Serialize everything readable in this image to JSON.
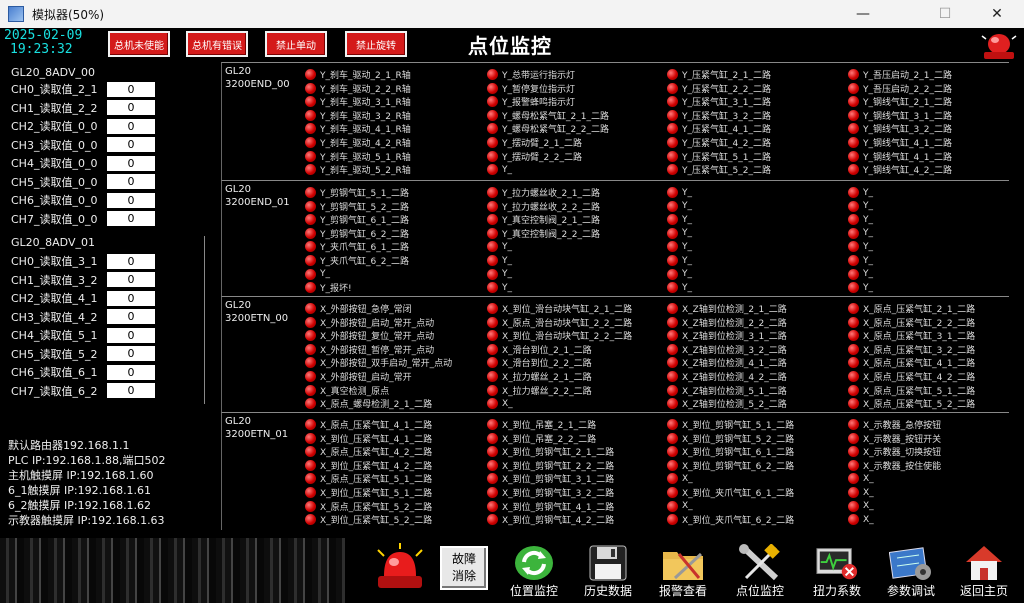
{
  "window": {
    "title": "模拟器(50%)",
    "minimize": "—",
    "maximize": "☐",
    "close": "✕"
  },
  "clock": {
    "date": "2025-02-09",
    "time": "19:23:32"
  },
  "top_buttons": [
    "总机未使能",
    "总机有错误",
    "禁止单动",
    "禁止旋转"
  ],
  "page_title": "点位监控",
  "modules": [
    {
      "title": "GL20_8ADV_00",
      "channels": [
        {
          "label": "CH0_读取值_2_1",
          "value": "0"
        },
        {
          "label": "CH1_读取值_2_2",
          "value": "0"
        },
        {
          "label": "CH2_读取值_0_0",
          "value": "0"
        },
        {
          "label": "CH3_读取值_0_0",
          "value": "0"
        },
        {
          "label": "CH4_读取值_0_0",
          "value": "0"
        },
        {
          "label": "CH5_读取值_0_0",
          "value": "0"
        },
        {
          "label": "CH6_读取值_0_0",
          "value": "0"
        },
        {
          "label": "CH7_读取值_0_0",
          "value": "0"
        }
      ]
    },
    {
      "title": "GL20_8ADV_01",
      "channels": [
        {
          "label": "CH0_读取值_3_1",
          "value": "0"
        },
        {
          "label": "CH1_读取值_3_2",
          "value": "0"
        },
        {
          "label": "CH2_读取值_4_1",
          "value": "0"
        },
        {
          "label": "CH3_读取值_4_2",
          "value": "0"
        },
        {
          "label": "CH4_读取值_5_1",
          "value": "0"
        },
        {
          "label": "CH5_读取值_5_2",
          "value": "0"
        },
        {
          "label": "CH6_读取值_6_1",
          "value": "0"
        },
        {
          "label": "CH7_读取值_6_2",
          "value": "0"
        }
      ]
    }
  ],
  "network_info": [
    "默认路由器192.168.1.1",
    "PLC IP:192.168.1.88,端口502",
    "主机触摸屏 IP:192.168.1.60",
    "6_1触摸屏 IP:192.168.1.61",
    "6_2触摸屏 IP:192.168.1.62",
    "示教器触摸屏 IP:192.168.1.63"
  ],
  "io_groups": [
    {
      "name": [
        "GL20",
        "3200END_00"
      ],
      "columns": [
        [
          "Y_刹车_驱动_2_1_R轴",
          "Y_刹车_驱动_2_2_R轴",
          "Y_刹车_驱动_3_1_R轴",
          "Y_刹车_驱动_3_2_R轴",
          "Y_刹车_驱动_4_1_R轴",
          "Y_刹车_驱动_4_2_R轴",
          "Y_刹车_驱动_5_1_R轴",
          "Y_刹车_驱动_5_2_R轴"
        ],
        [
          "Y_总带运行指示灯",
          "Y_暂停复位指示灯",
          "Y_报警蜂鸣指示灯",
          "Y_螺母松紧气缸_2_1_二路",
          "Y_螺母松紧气缸_2_2_二路",
          "Y_摆动臂_2_1_二路",
          "Y_摆动臂_2_2_二路",
          "Y_"
        ],
        [
          "Y_压紧气缸_2_1_二路",
          "Y_压紧气缸_2_2_二路",
          "Y_压紧气缸_3_1_二路",
          "Y_压紧气缸_3_2_二路",
          "Y_压紧气缸_4_1_二路",
          "Y_压紧气缸_4_2_二路",
          "Y_压紧气缸_5_1_二路",
          "Y_压紧气缸_5_2_二路"
        ],
        [
          "Y_吾压启动_2_1_二路",
          "Y_吾压启动_2_2_二路",
          "Y_钢线气缸_2_1_二路",
          "Y_钢线气缸_3_1_二路",
          "Y_钢线气缸_3_2_二路",
          "Y_钢线气缸_4_1_二路",
          "Y_钢线气缸_4_1_二路",
          "Y_钢线气缸_4_2_二路"
        ]
      ]
    },
    {
      "name": [
        "GL20",
        "3200END_01"
      ],
      "columns": [
        [
          "Y_剪钢气缸_5_1_二路",
          "Y_剪钢气缸_5_2_二路",
          "Y_剪钢气缸_6_1_二路",
          "Y_剪钢气缸_6_2_二路",
          "Y_夹爪气缸_6_1_二路",
          "Y_夹爪气缸_6_2_二路",
          "Y_",
          "Y_报坏!"
        ],
        [
          "Y_拉力螺丝收_2_1_二路",
          "Y_拉力螺丝收_2_2_二路",
          "Y_真空控制阀_2_1_二路",
          "Y_真空控制阀_2_2_二路",
          "Y_",
          "Y_",
          "Y_",
          "Y_"
        ],
        [
          "Y_",
          "Y_",
          "Y_",
          "Y_",
          "Y_",
          "Y_",
          "Y_",
          "Y_"
        ],
        [
          "Y_",
          "Y_",
          "Y_",
          "Y_",
          "Y_",
          "Y_",
          "Y_",
          "Y_"
        ]
      ]
    },
    {
      "name": [
        "GL20",
        "3200ETN_00"
      ],
      "columns": [
        [
          "X_外部按钮_急停_常闭",
          "X_外部按钮_启动_常开_点动",
          "X_外部按钮_复位_常开_点动",
          "X_外部按钮_暂停_常开_点动",
          "X_外部按钮_双手启动_常开_点动",
          "X_外部按钮_启动_常开",
          "X_真空检测_原点",
          "X_原点_螺母检测_2_1_二路"
        ],
        [
          "X_到位_滑台动块气缸_2_1_二路",
          "X_原点_滑台动块气缸_2_2_二路",
          "X_到位_滑台动块气缸_2_2_二路",
          "X_滑台到位_2_1_二路",
          "X_滑台到位_2_2_二路",
          "X_拉力螺丝_2_1_二路",
          "X_拉力螺丝_2_2_二路",
          "X_"
        ],
        [
          "X_Z轴到位检测_2_1_二路",
          "X_Z轴到位检测_2_2_二路",
          "X_Z轴到位检测_3_1_二路",
          "X_Z轴到位检测_3_2_二路",
          "X_Z轴到位检测_4_1_二路",
          "X_Z轴到位检测_4_2_二路",
          "X_Z轴到位检测_5_1_二路",
          "X_Z轴到位检测_5_2_二路"
        ],
        [
          "X_原点_压紧气缸_2_1_二路",
          "X_原点_压紧气缸_2_2_二路",
          "X_原点_压紧气缸_3_1_二路",
          "X_原点_压紧气缸_3_2_二路",
          "X_原点_压紧气缸_4_1_二路",
          "X_原点_压紧气缸_4_2_二路",
          "X_原点_压紧气缸_5_1_二路",
          "X_原点_压紧气缸_5_2_二路"
        ]
      ]
    },
    {
      "name": [
        "GL20",
        "3200ETN_01"
      ],
      "columns": [
        [
          "X_原点_压紧气缸_4_1_二路",
          "X_到位_压紧气缸_4_1_二路",
          "X_原点_压紧气缸_4_2_二路",
          "X_到位_压紧气缸_4_2_二路",
          "X_原点_压紧气缸_5_1_二路",
          "X_到位_压紧气缸_5_1_二路",
          "X_原点_压紧气缸_5_2_二路",
          "X_到位_压紧气缸_5_2_二路"
        ],
        [
          "X_到位_吊塞_2_1_二路",
          "X_到位_吊塞_2_2_二路",
          "X_到位_剪钢气缸_2_1_二路",
          "X_到位_剪钢气缸_2_2_二路",
          "X_到位_剪钢气缸_3_1_二路",
          "X_到位_剪钢气缸_3_2_二路",
          "X_到位_剪钢气缸_4_1_二路",
          "X_到位_剪钢气缸_4_2_二路"
        ],
        [
          "X_到位_剪钢气缸_5_1_二路",
          "X_到位_剪钢气缸_5_2_二路",
          "X_到位_剪钢气缸_6_1_二路",
          "X_到位_剪钢气缸_6_2_二路",
          "X_",
          "X_到位_夹爪气缸_6_1_二路",
          "X_",
          "X_到位_夹爪气缸_6_2_二路"
        ],
        [
          "X_示教器_急停按钮",
          "X_示教器_按钮开关",
          "X_示教器_切换按钮",
          "X_示教器_按住使能",
          "X_",
          "X_",
          "X_",
          "X_"
        ]
      ]
    }
  ],
  "bottom": {
    "clear_fault": [
      "故障",
      "消除"
    ],
    "nav": [
      "位置监控",
      "历史数据",
      "报警查看",
      "点位监控",
      "扭力系数",
      "参数调试",
      "返回主页"
    ]
  },
  "colors": {
    "led_on": "#d00000",
    "button_red": "#d41a1a",
    "clock": "#19e0e0",
    "background": "#000000"
  }
}
